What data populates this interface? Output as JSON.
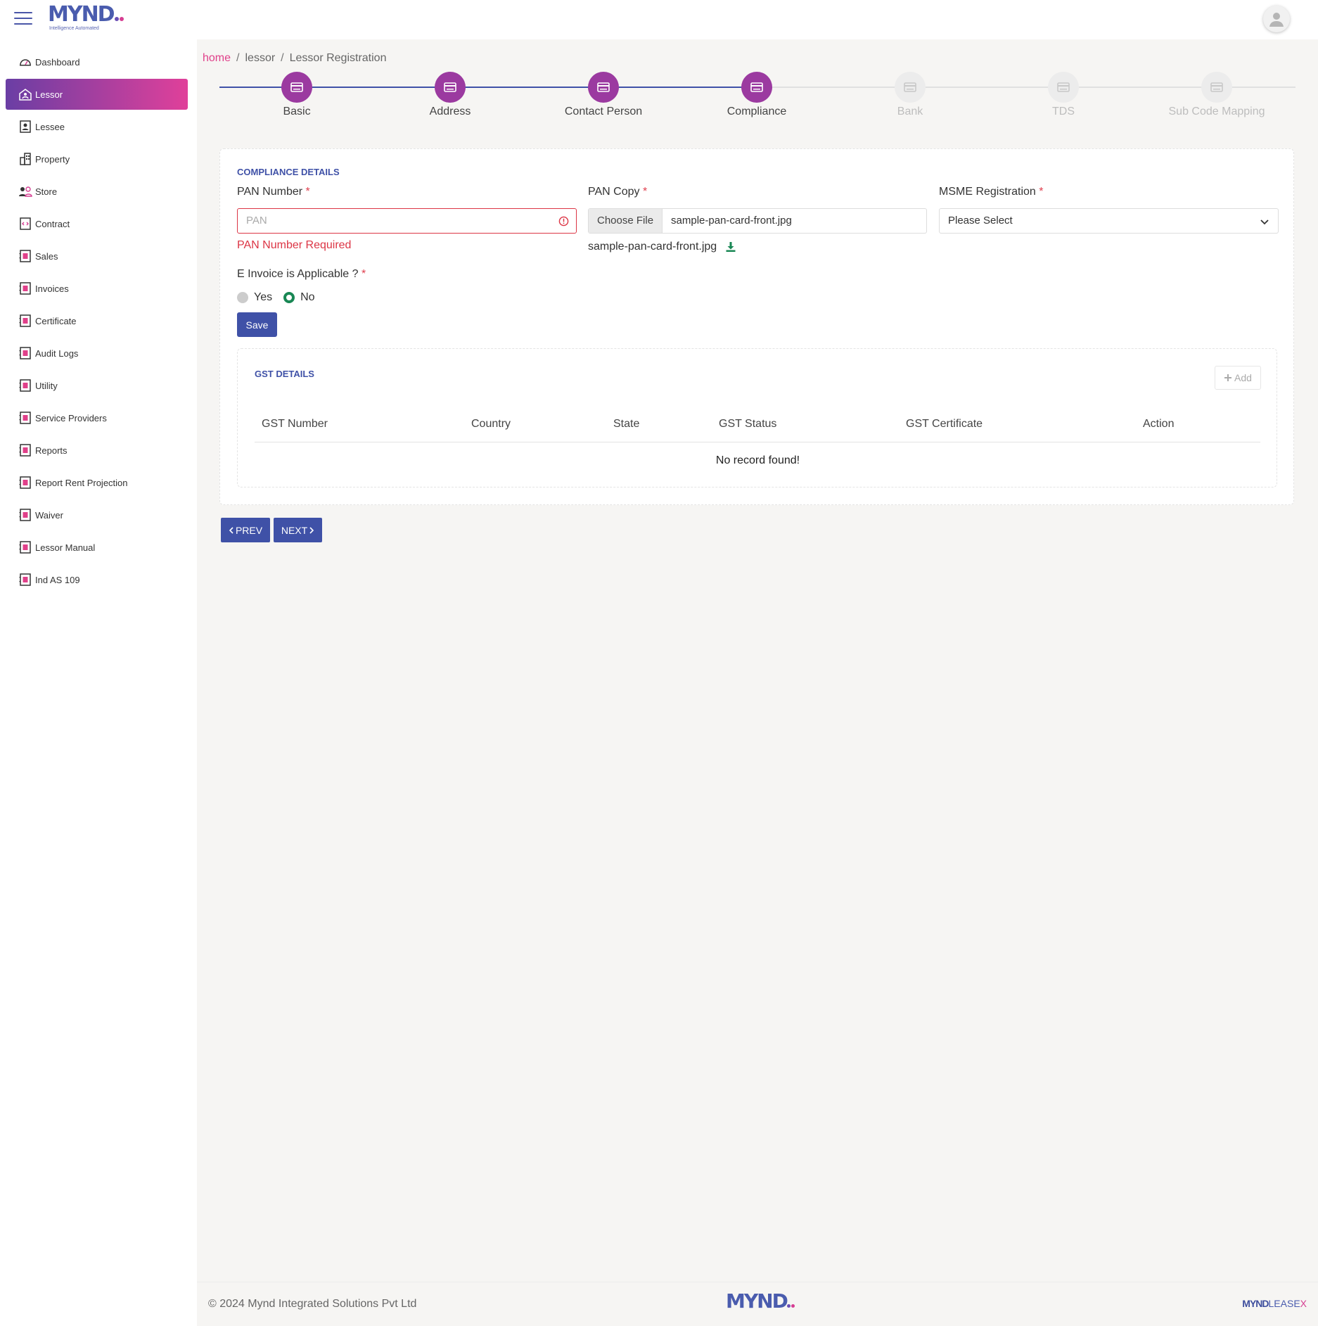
{
  "brand": {
    "logo_text": "MYND",
    "tagline": "Intelligence Automated"
  },
  "sidebar": {
    "items": [
      {
        "label": "Dashboard",
        "icon": "dashboard-icon",
        "active": false
      },
      {
        "label": "Lessor",
        "icon": "lessor-icon",
        "active": true
      },
      {
        "label": "Lessee",
        "icon": "lessee-icon",
        "active": false
      },
      {
        "label": "Property",
        "icon": "building-icon",
        "active": false
      },
      {
        "label": "Store",
        "icon": "users-icon",
        "active": false
      },
      {
        "label": "Contract",
        "icon": "contract-icon",
        "active": false
      },
      {
        "label": "Sales",
        "icon": "doc-icon",
        "active": false
      },
      {
        "label": "Invoices",
        "icon": "doc-icon",
        "active": false
      },
      {
        "label": "Certificate",
        "icon": "doc-icon",
        "active": false
      },
      {
        "label": "Audit Logs",
        "icon": "doc-icon",
        "active": false
      },
      {
        "label": "Utility",
        "icon": "doc-icon",
        "active": false
      },
      {
        "label": "Service Providers",
        "icon": "doc-icon",
        "active": false
      },
      {
        "label": "Reports",
        "icon": "doc-icon",
        "active": false
      },
      {
        "label": "Report Rent Projection",
        "icon": "doc-icon",
        "active": false
      },
      {
        "label": "Waiver",
        "icon": "doc-icon",
        "active": false
      },
      {
        "label": "Lessor Manual",
        "icon": "doc-icon",
        "active": false
      },
      {
        "label": "Ind AS 109",
        "icon": "doc-icon",
        "active": false
      }
    ]
  },
  "breadcrumb": {
    "home": "home",
    "section": "lessor",
    "current": "Lessor Registration"
  },
  "stepper": {
    "steps": [
      {
        "label": "Basic",
        "done": true
      },
      {
        "label": "Address",
        "done": true
      },
      {
        "label": "Contact Person",
        "done": true
      },
      {
        "label": "Compliance",
        "done": true
      },
      {
        "label": "Bank",
        "done": false
      },
      {
        "label": "TDS",
        "done": false
      },
      {
        "label": "Sub Code Mapping",
        "done": false
      }
    ]
  },
  "compliance": {
    "title": "COMPLIANCE DETAILS",
    "pan_label": "PAN Number",
    "pan_placeholder": "PAN",
    "pan_value": "",
    "pan_error": "PAN Number Required",
    "pan_copy_label": "PAN Copy",
    "choose_file": "Choose File",
    "file_name": "sample-pan-card-front.jpg",
    "uploaded_file": "sample-pan-card-front.jpg",
    "msme_label": "MSME Registration",
    "msme_selected": "Please Select",
    "einvoice_label": "E Invoice is Applicable ?",
    "yes_label": "Yes",
    "no_label": "No",
    "einvoice_value": "No",
    "required_mark": "*",
    "save_label": "Save"
  },
  "gst": {
    "title": "GST DETAILS",
    "add_label": "Add",
    "columns": [
      "GST Number",
      "Country",
      "State",
      "GST Status",
      "GST Certificate",
      "Action"
    ],
    "rows": [],
    "empty_text": "No record found!"
  },
  "nav": {
    "prev_label": "PREV",
    "next_label": "NEXT"
  },
  "footer": {
    "copyright": "© 2024 Mynd Integrated Solutions Pvt Ltd",
    "product_a": "MYND",
    "product_b": "LEASE",
    "product_c": "X"
  },
  "colors": {
    "primary": "#3f51a7",
    "accent": "#e0408a",
    "step_done": "#9b3aa0",
    "error": "#dc3545",
    "success": "#198754"
  }
}
